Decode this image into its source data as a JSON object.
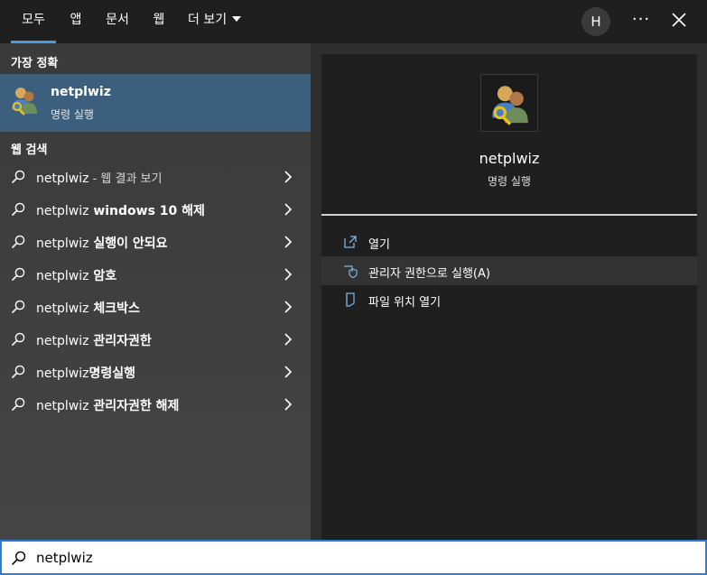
{
  "colors": {
    "accent": "#4c9bd8",
    "selected_bg": "#3d5f7e",
    "search_border": "#2a7fd4"
  },
  "tabs": [
    {
      "label": "모두",
      "active": true
    },
    {
      "label": "앱"
    },
    {
      "label": "문서"
    },
    {
      "label": "웹"
    },
    {
      "label": "더 보기"
    }
  ],
  "header": {
    "avatar_initial": "H",
    "more_icon": "more-icon",
    "close_icon": "close-icon"
  },
  "best_match": {
    "header": "가장 정확",
    "title": "netplwiz",
    "subtitle": "명령 실행",
    "icon": "user-accounts-icon"
  },
  "web_search": {
    "header": "웹 검색",
    "items": [
      {
        "query": "netplwiz",
        "suffix": " - 웹 결과 보기"
      },
      {
        "query": "netplwiz",
        "bold": " windows 10 해제"
      },
      {
        "query": "netplwiz",
        "bold": " 실행이 안되요"
      },
      {
        "query": "netplwiz",
        "bold": " 암호"
      },
      {
        "query": "netplwiz",
        "bold": " 체크박스"
      },
      {
        "query": "netplwiz",
        "bold": " 관리자권한"
      },
      {
        "query": "netplwiz",
        "bold": "명령실행"
      },
      {
        "query": "netplwiz",
        "bold": " 관리자권한 해제"
      }
    ]
  },
  "preview": {
    "title": "netplwiz",
    "subtitle": "명령 실행",
    "actions": [
      {
        "label": "열기",
        "icon": "open-icon"
      },
      {
        "label": "관리자 권한으로 실행(A)",
        "icon": "shield-icon"
      },
      {
        "label": "파일 위치 열기",
        "icon": "file-location-icon"
      }
    ]
  },
  "search": {
    "value": "netplwiz",
    "icon": "search-icon"
  }
}
